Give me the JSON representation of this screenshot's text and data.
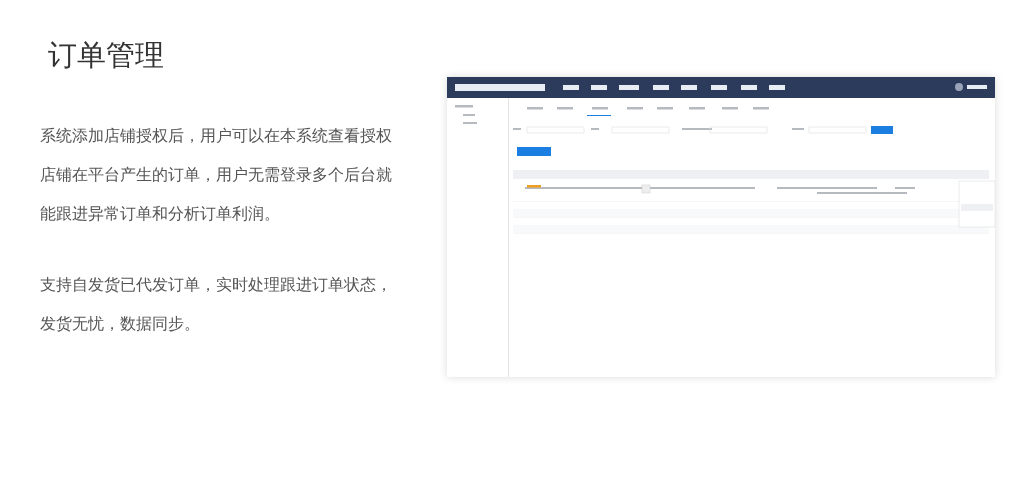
{
  "heading": "订单管理",
  "paragraphs": [
    "系统添加店铺授权后，用户可以在本系统查看授权店铺在平台产生的订单，用户无需登录多个后台就能跟进异常订单和分析订单利润。",
    "支持自发货已代发订单，实时处理跟进订单状态，发货无忧，数据同步。"
  ]
}
